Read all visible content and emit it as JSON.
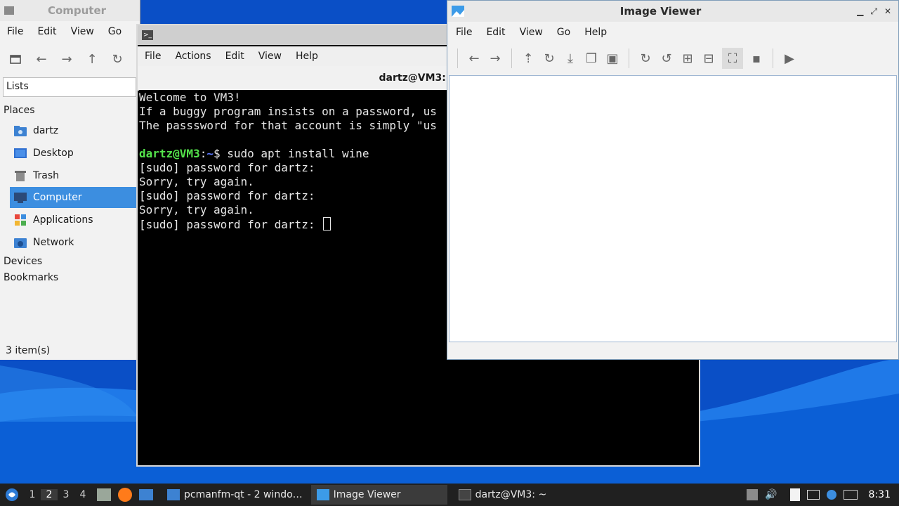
{
  "colors": {
    "accent": "#3c8ee0",
    "terminal_bg": "#000000",
    "prompt_user": "#54e34b",
    "prompt_path": "#5a78ff",
    "taskbar_bg": "#202020"
  },
  "file_manager": {
    "title": "Computer",
    "menu": [
      "File",
      "Edit",
      "View",
      "Go"
    ],
    "toolbar_icons": [
      "new-tab-icon",
      "back-icon",
      "forward-icon",
      "up-icon",
      "reload-icon"
    ],
    "side_pane_mode": "Lists",
    "sections": {
      "places": "Places",
      "devices": "Devices",
      "bookmarks": "Bookmarks"
    },
    "places": [
      {
        "label": "dartz",
        "icon": "home-folder-icon"
      },
      {
        "label": "Desktop",
        "icon": "desktop-icon"
      },
      {
        "label": "Trash",
        "icon": "trash-icon"
      },
      {
        "label": "Computer",
        "icon": "computer-icon",
        "selected": true
      },
      {
        "label": "Applications",
        "icon": "applications-icon"
      },
      {
        "label": "Network",
        "icon": "network-icon"
      }
    ],
    "status": "3 item(s)"
  },
  "terminal": {
    "title": "dartz@VM3:",
    "menu": [
      "File",
      "Actions",
      "Edit",
      "View",
      "Help"
    ],
    "tab_title": "dartz@VM3: ~",
    "lines": [
      "Welcome to VM3!",
      "If a buggy program insists on a password, us",
      "The passsword for that account is simply \"us",
      ""
    ],
    "prompt": {
      "user": "dartz@VM3",
      "sep": ":",
      "path": "~",
      "dollar": "$ ",
      "command": "sudo apt install wine"
    },
    "output": [
      "[sudo] password for dartz:",
      "Sorry, try again.",
      "[sudo] password for dartz:",
      "Sorry, try again."
    ],
    "last_line": "[sudo] password for dartz: "
  },
  "image_viewer": {
    "title": "Image Viewer",
    "menu": [
      "File",
      "Edit",
      "View",
      "Go",
      "Help"
    ],
    "toolbar_icons": [
      "previous-icon",
      "next-icon",
      "upload-icon",
      "reload-icon",
      "save-icon",
      "copy-icon",
      "paste-icon",
      "rotate-clockwise-icon",
      "rotate-counterclockwise-icon",
      "zoom-in-icon",
      "zoom-out-icon",
      "fit-window-icon",
      "original-size-icon",
      "slideshow-icon"
    ]
  },
  "taskbar": {
    "workspaces": [
      "1",
      "2",
      "3",
      "4"
    ],
    "active_workspace": "2",
    "tasks": [
      {
        "label": "pcmanfm-qt - 2 windo…",
        "icon": "folder-icon"
      },
      {
        "label": "Image Viewer",
        "icon": "image-viewer-icon",
        "active": true
      },
      {
        "label": "dartz@VM3: ~",
        "icon": "terminal-icon"
      }
    ],
    "clock": "8:31"
  }
}
